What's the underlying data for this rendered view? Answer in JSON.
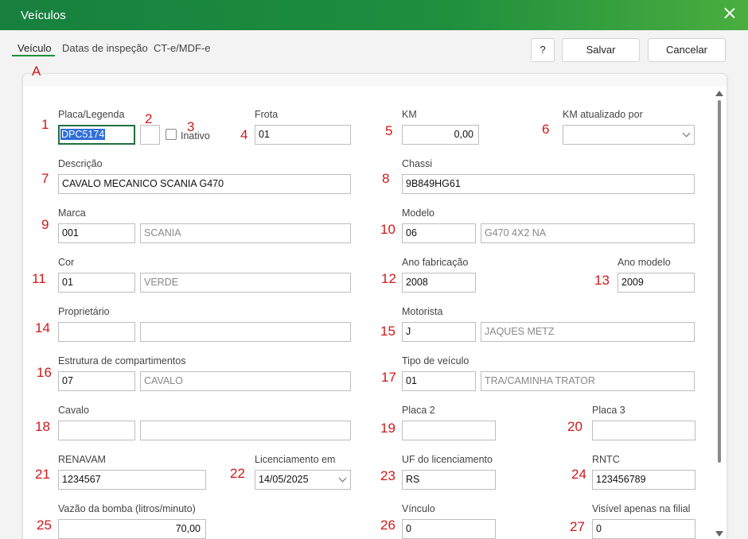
{
  "window": {
    "title": "Veículos"
  },
  "tabs": [
    "Veículo",
    "Datas de inspeção",
    "CT-e/MDF-e"
  ],
  "buttons": {
    "help": "?",
    "save": "Salvar",
    "cancel": "Cancelar"
  },
  "markers": [
    "A",
    "1",
    "2",
    "3",
    "4",
    "5",
    "6",
    "7",
    "8",
    "9",
    "10",
    "11",
    "12",
    "13",
    "14",
    "15",
    "16",
    "17",
    "18",
    "19",
    "20",
    "21",
    "22",
    "23",
    "24",
    "25",
    "26",
    "27"
  ],
  "form": {
    "placa_label": "Placa/Legenda",
    "placa": "DPC5174",
    "legenda": "",
    "inativo_label": "Inativo",
    "frota_label": "Frota",
    "frota": "01",
    "km_label": "KM",
    "km": "0,00",
    "km_atualizado_label": "KM atualizado por",
    "km_atualizado": "",
    "descricao_label": "Descrição",
    "descricao": "CAVALO MECANICO SCANIA G470",
    "chassi_label": "Chassi",
    "chassi": "9B849HG61",
    "marca_label": "Marca",
    "marca_code": "001",
    "marca_name": "SCANIA",
    "modelo_label": "Modelo",
    "modelo_code": "06",
    "modelo_name": "G470 4X2 NA",
    "cor_label": "Cor",
    "cor_code": "01",
    "cor_name": "VERDE",
    "ano_fab_label": "Ano fabricação",
    "ano_fab": "2008",
    "ano_modelo_label": "Ano modelo",
    "ano_modelo": "2009",
    "proprietario_label": "Proprietário",
    "proprietario_code": "",
    "proprietario_name": "",
    "motorista_label": "Motorista",
    "motorista_code": "J",
    "motorista_name": "JAQUES METZ",
    "estrutura_label": "Estrutura de compartimentos",
    "estrutura_code": "07",
    "estrutura_name": "CAVALO",
    "tipo_label": "Tipo de veículo",
    "tipo_code": "01",
    "tipo_name": "TRA/CAMINHA TRATOR",
    "cavalo_label": "Cavalo",
    "cavalo_code": "",
    "cavalo_name": "",
    "placa2_label": "Placa 2",
    "placa2": "",
    "placa3_label": "Placa 3",
    "placa3": "",
    "renavam_label": "RENAVAM",
    "renavam": "1234567",
    "licenciamento_label": "Licenciamento em",
    "licenciamento": "14/05/2025",
    "uf_label": "UF do licenciamento",
    "uf": "RS",
    "rntc_label": "RNTC",
    "rntc": "123456789",
    "vazao_label": "Vazão da bomba (litros/minuto)",
    "vazao": "70,00",
    "vinculo_label": "Vínculo",
    "vinculo": "0",
    "visivel_label": "Visível apenas na filial",
    "visivel": "0"
  }
}
